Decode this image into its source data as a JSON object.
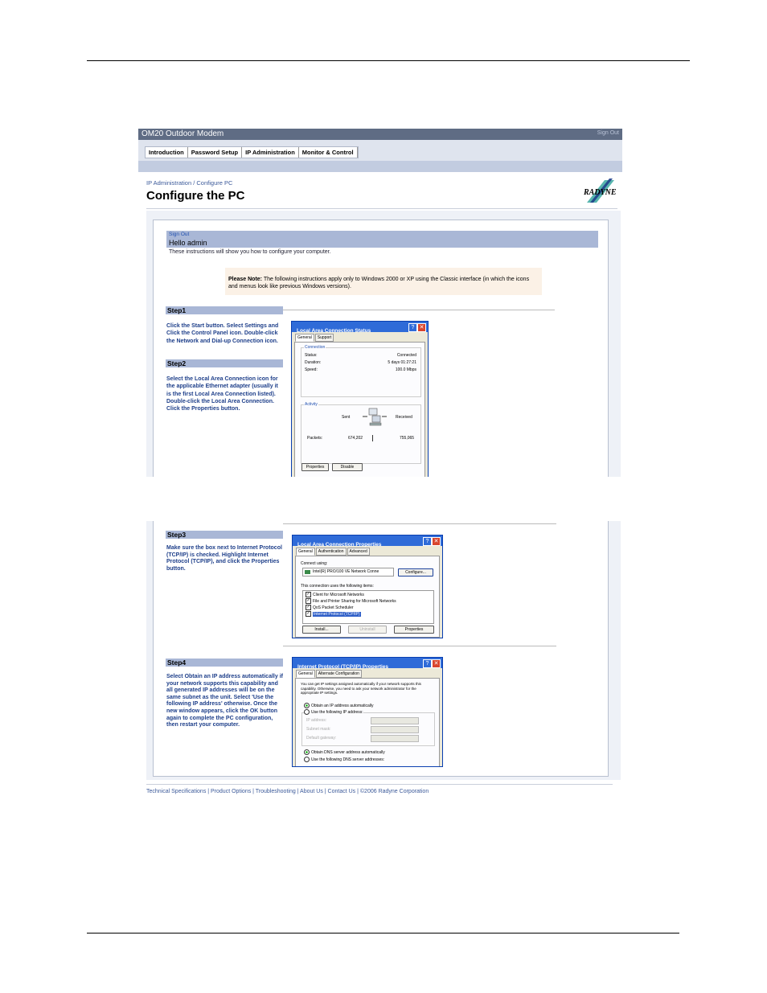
{
  "app": {
    "title": "OM20 Outdoor Modem",
    "sign_out": "Sign Out",
    "nav": [
      "Introduction",
      "Password Setup",
      "IP Administration",
      "Monitor & Control"
    ]
  },
  "page": {
    "breadcrumb": "IP Administration / Configure PC",
    "title": "Configure the PC",
    "logo": "RADYNE",
    "panel_sign_out": "Sign Out",
    "greeting": "Hello admin",
    "intro": "These instructions will show you how to configure your computer.",
    "note_label": "Please Note:",
    "note_text": "The following instructions apply only to Windows 2000 or XP using the Classic interface (in which the icons and menus look like previous Windows versions)."
  },
  "steps": [
    {
      "label": "Step1",
      "text": "Click the Start button. Select Settings and Click the Control Panel icon. Double-click the Network and Dial-up Connection icon."
    },
    {
      "label": "Step2",
      "text": "Select the Local Area Connection icon for the applicable Ethernet adapter (usually it is the first Local Area Connection listed). Double-click the Local Area Connection. Click the Properties button."
    },
    {
      "label": "Step3",
      "text": "Make sure the box next to Internet Protocol (TCP/IP) is checked. Highlight Internet Protocol (TCP/IP), and click the Properties button."
    },
    {
      "label": "Step4",
      "text": "Select Obtain an IP address automatically if your network supports this capability and all generated IP addresses will be on the same subnet as the unit. Select 'Use the following IP address' otherwise. Once the new window appears, click the OK button again to complete the PC configuration, then restart your computer."
    }
  ],
  "dialog_status": {
    "title": "Local Area Connection Status",
    "tabs": [
      "General",
      "Support"
    ],
    "connection_caption": "Connection",
    "rows": [
      {
        "label": "Status:",
        "value": "Connected"
      },
      {
        "label": "Duration:",
        "value": "5 days 01:27:21"
      },
      {
        "label": "Speed:",
        "value": "100.0 Mbps"
      }
    ],
    "activity_caption": "Activity",
    "sent": "Sent",
    "received": "Received",
    "packets_label": "Packets:",
    "packets_sent": "674,202",
    "packets_received": "755,065",
    "btn_properties": "Properties",
    "btn_disable": "Disable"
  },
  "dialog_props": {
    "title": "Local Area Connection Properties",
    "tabs": [
      "General",
      "Authentication",
      "Advanced"
    ],
    "connect_using": "Connect using:",
    "adapter": "Intel(R) PRO/100 VE Network Conne",
    "configure": "Configure...",
    "items_label": "This connection uses the following items:",
    "items": [
      "Client for Microsoft Networks",
      "File and Printer Sharing for Microsoft Networks",
      "QoS Packet Scheduler",
      "Internet Protocol (TCP/IP)"
    ],
    "btn_install": "Install...",
    "btn_uninstall": "Uninstall",
    "btn_properties": "Properties"
  },
  "dialog_tcpip": {
    "title": "Internet Protocol (TCP/IP) Properties",
    "tabs": [
      "General",
      "Alternate Configuration"
    ],
    "desc": "You can get IP settings assigned automatically if your network supports this capability. Otherwise, you need to ask your network administrator for the appropriate IP settings.",
    "opt_auto": "Obtain an IP address automatically",
    "opt_manual": "Use the following IP address:",
    "ip_label": "IP address:",
    "mask_label": "Subnet mask:",
    "gw_label": "Default gateway:",
    "dns_auto": "Obtain DNS server address automatically",
    "dns_manual": "Use the following DNS server addresses:"
  },
  "footer": {
    "links": "Technical Specifications | Product Options | Troubleshooting | About Us | Contact Us | ©2006 Radyne Corporation"
  },
  "colors": {
    "accent": "#2f6bd8",
    "step_text": "#1e3f8a",
    "nav_bar": "#5f6c84"
  }
}
